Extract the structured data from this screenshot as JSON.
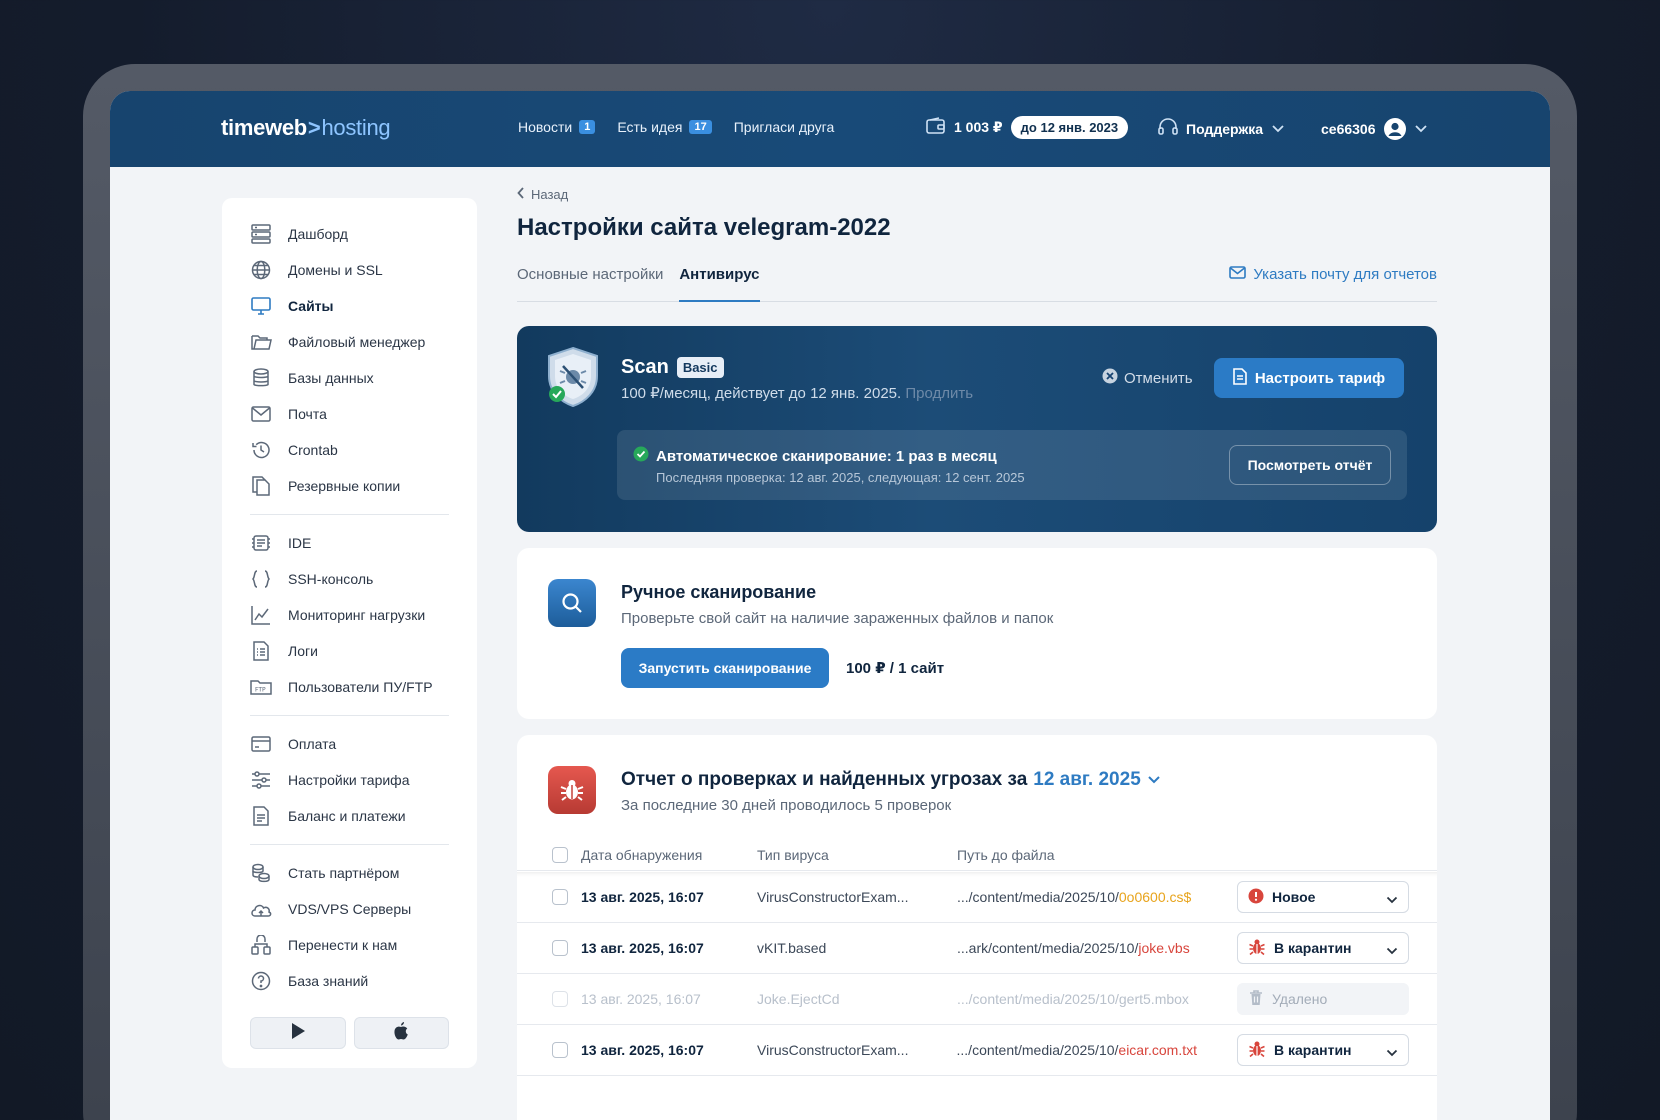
{
  "header": {
    "logo_brand": "timeweb",
    "logo_sep": ">",
    "logo_product": "hosting",
    "nav": [
      {
        "label": "Новости",
        "badge": "1"
      },
      {
        "label": "Есть идея",
        "badge": "17"
      },
      {
        "label": "Пригласи друга",
        "badge": ""
      }
    ],
    "balance": "1 003 ₽",
    "paid_until": "до 12 янв. 2023",
    "support_label": "Поддержка",
    "username": "ce66306"
  },
  "sidebar": {
    "group1": [
      {
        "label": "Дашборд",
        "icon": "server-icon"
      },
      {
        "label": "Домены и SSL",
        "icon": "globe-icon"
      },
      {
        "label": "Сайты",
        "icon": "monitor-icon",
        "active": true
      },
      {
        "label": "Файловый менеджер",
        "icon": "folder-icon"
      },
      {
        "label": "Базы данных",
        "icon": "database-icon"
      },
      {
        "label": "Почта",
        "icon": "mail-icon"
      },
      {
        "label": "Crontab",
        "icon": "clock-icon"
      },
      {
        "label": "Резервные копии",
        "icon": "copy-icon"
      }
    ],
    "group2": [
      {
        "label": "IDE",
        "icon": "ide-icon"
      },
      {
        "label": "SSH-консоль",
        "icon": "braces-icon"
      },
      {
        "label": "Мониторинг нагрузки",
        "icon": "chart-icon"
      },
      {
        "label": "Логи",
        "icon": "log-icon"
      },
      {
        "label": "Пользователи ПУ/FTP",
        "icon": "ftp-icon"
      }
    ],
    "group3": [
      {
        "label": "Оплата",
        "icon": "card-icon"
      },
      {
        "label": "Настройки тарифа",
        "icon": "sliders-icon"
      },
      {
        "label": "Баланс и платежи",
        "icon": "document-icon"
      }
    ],
    "group4": [
      {
        "label": "Стать партнёром",
        "icon": "coins-icon"
      },
      {
        "label": "VDS/VPS Серверы",
        "icon": "cloud-icon"
      },
      {
        "label": "Перенести к нам",
        "icon": "transfer-icon"
      },
      {
        "label": "База знаний",
        "icon": "help-icon"
      }
    ]
  },
  "main": {
    "back_label": "Назад",
    "title": "Настройки сайта velegram-2022",
    "tabs": [
      "Основные настройки",
      "Антивирус"
    ],
    "mail_link": "Указать почту для отчетов",
    "scan": {
      "name": "Scan",
      "plan": "Basic",
      "price_text": "100 ₽/месяц, действует до 12 янв. 2025.",
      "extend_label": "Продлить",
      "cancel_label": "Отменить",
      "tariff_button": "Настроить тариф",
      "auto_title": "Автоматическое сканирование: 1 раз в месяц",
      "auto_sub": "Последняя проверка: 12 авг. 2025, следующая: 12 сент. 2025",
      "report_button": "Посмотреть отчёт"
    },
    "manual": {
      "title": "Ручное сканирование",
      "subtitle": "Проверьте свой сайт на наличие зараженных файлов и папок",
      "run_button": "Запустить сканирование",
      "price": "100 ₽ / 1 сайт"
    },
    "report": {
      "title_prefix": "Отчет о проверках и найденных угрозах за",
      "title_date": "12 авг. 2025",
      "subtitle": "За последние 30 дней проводилось 5 проверок",
      "columns": [
        "Дата обнаружения",
        "Тип вируса",
        "Путь до файла"
      ],
      "rows": [
        {
          "date": "13 авг. 2025, 16:07",
          "type": "VirusConstructorExam...",
          "path": ".../content/media/2025/10/",
          "file": "0o0600.cs$",
          "file_color": "#e8a41c",
          "status": "Новое",
          "status_icon": "alert-icon"
        },
        {
          "date": "13 авг. 2025, 16:07",
          "type": "vKIT.based",
          "path": "...ark/content/media/2025/10/",
          "file": "joke.vbs",
          "file_color": "#d8453c",
          "status": "В карантин",
          "status_icon": "bug-icon"
        },
        {
          "date": "13 авг. 2025, 16:07",
          "type": "Joke.EjectCd",
          "path": ".../content/media/2025/10/",
          "file": "gert5.mbox",
          "file_color": "#b8c0cb",
          "status": "Удалено",
          "status_icon": "trash-icon"
        },
        {
          "date": "13 авг. 2025, 16:07",
          "type": "VirusConstructorExam...",
          "path": ".../content/media/2025/10/",
          "file": "eicar.com.txt",
          "file_color": "#d8453c",
          "status": "В карантин",
          "status_icon": "bug-icon"
        }
      ]
    }
  }
}
